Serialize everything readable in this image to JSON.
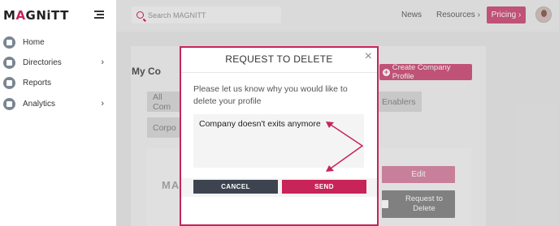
{
  "sidebar": {
    "logo_prefix": "M",
    "logo_accent": "A",
    "logo_suffix": "GNiTT",
    "items": [
      {
        "label": "Home",
        "icon": "home-icon"
      },
      {
        "label": "Directories",
        "icon": "directories-icon",
        "chevron": "›"
      },
      {
        "label": "Reports",
        "icon": "reports-icon"
      },
      {
        "label": "Analytics",
        "icon": "analytics-icon",
        "chevron": "›"
      }
    ]
  },
  "topbar": {
    "search_placeholder": "Search MAGNITT",
    "news": "News",
    "resources": "Resources ›",
    "pricing": "Pricing ›"
  },
  "background": {
    "panel_title": "My Co",
    "create_button": "Create Company Profile",
    "chips": [
      "All Com",
      "Enablers",
      "Corpo"
    ],
    "card_logo": "MA",
    "edit_button": "Edit",
    "request_delete_button": "Request to Delete"
  },
  "modal": {
    "title": "REQUEST TO DELETE",
    "close": "×",
    "prompt": "Please let us know why you would like to delete your profile",
    "reason_value": "Company doesn't exits anymore",
    "cancel_button": "CANCEL",
    "send_button": "SEND"
  },
  "colors": {
    "brand": "#c8245a",
    "pricing": "#d05a80",
    "cancel": "#3d4450",
    "sidebar_icon": "#7a8592"
  }
}
